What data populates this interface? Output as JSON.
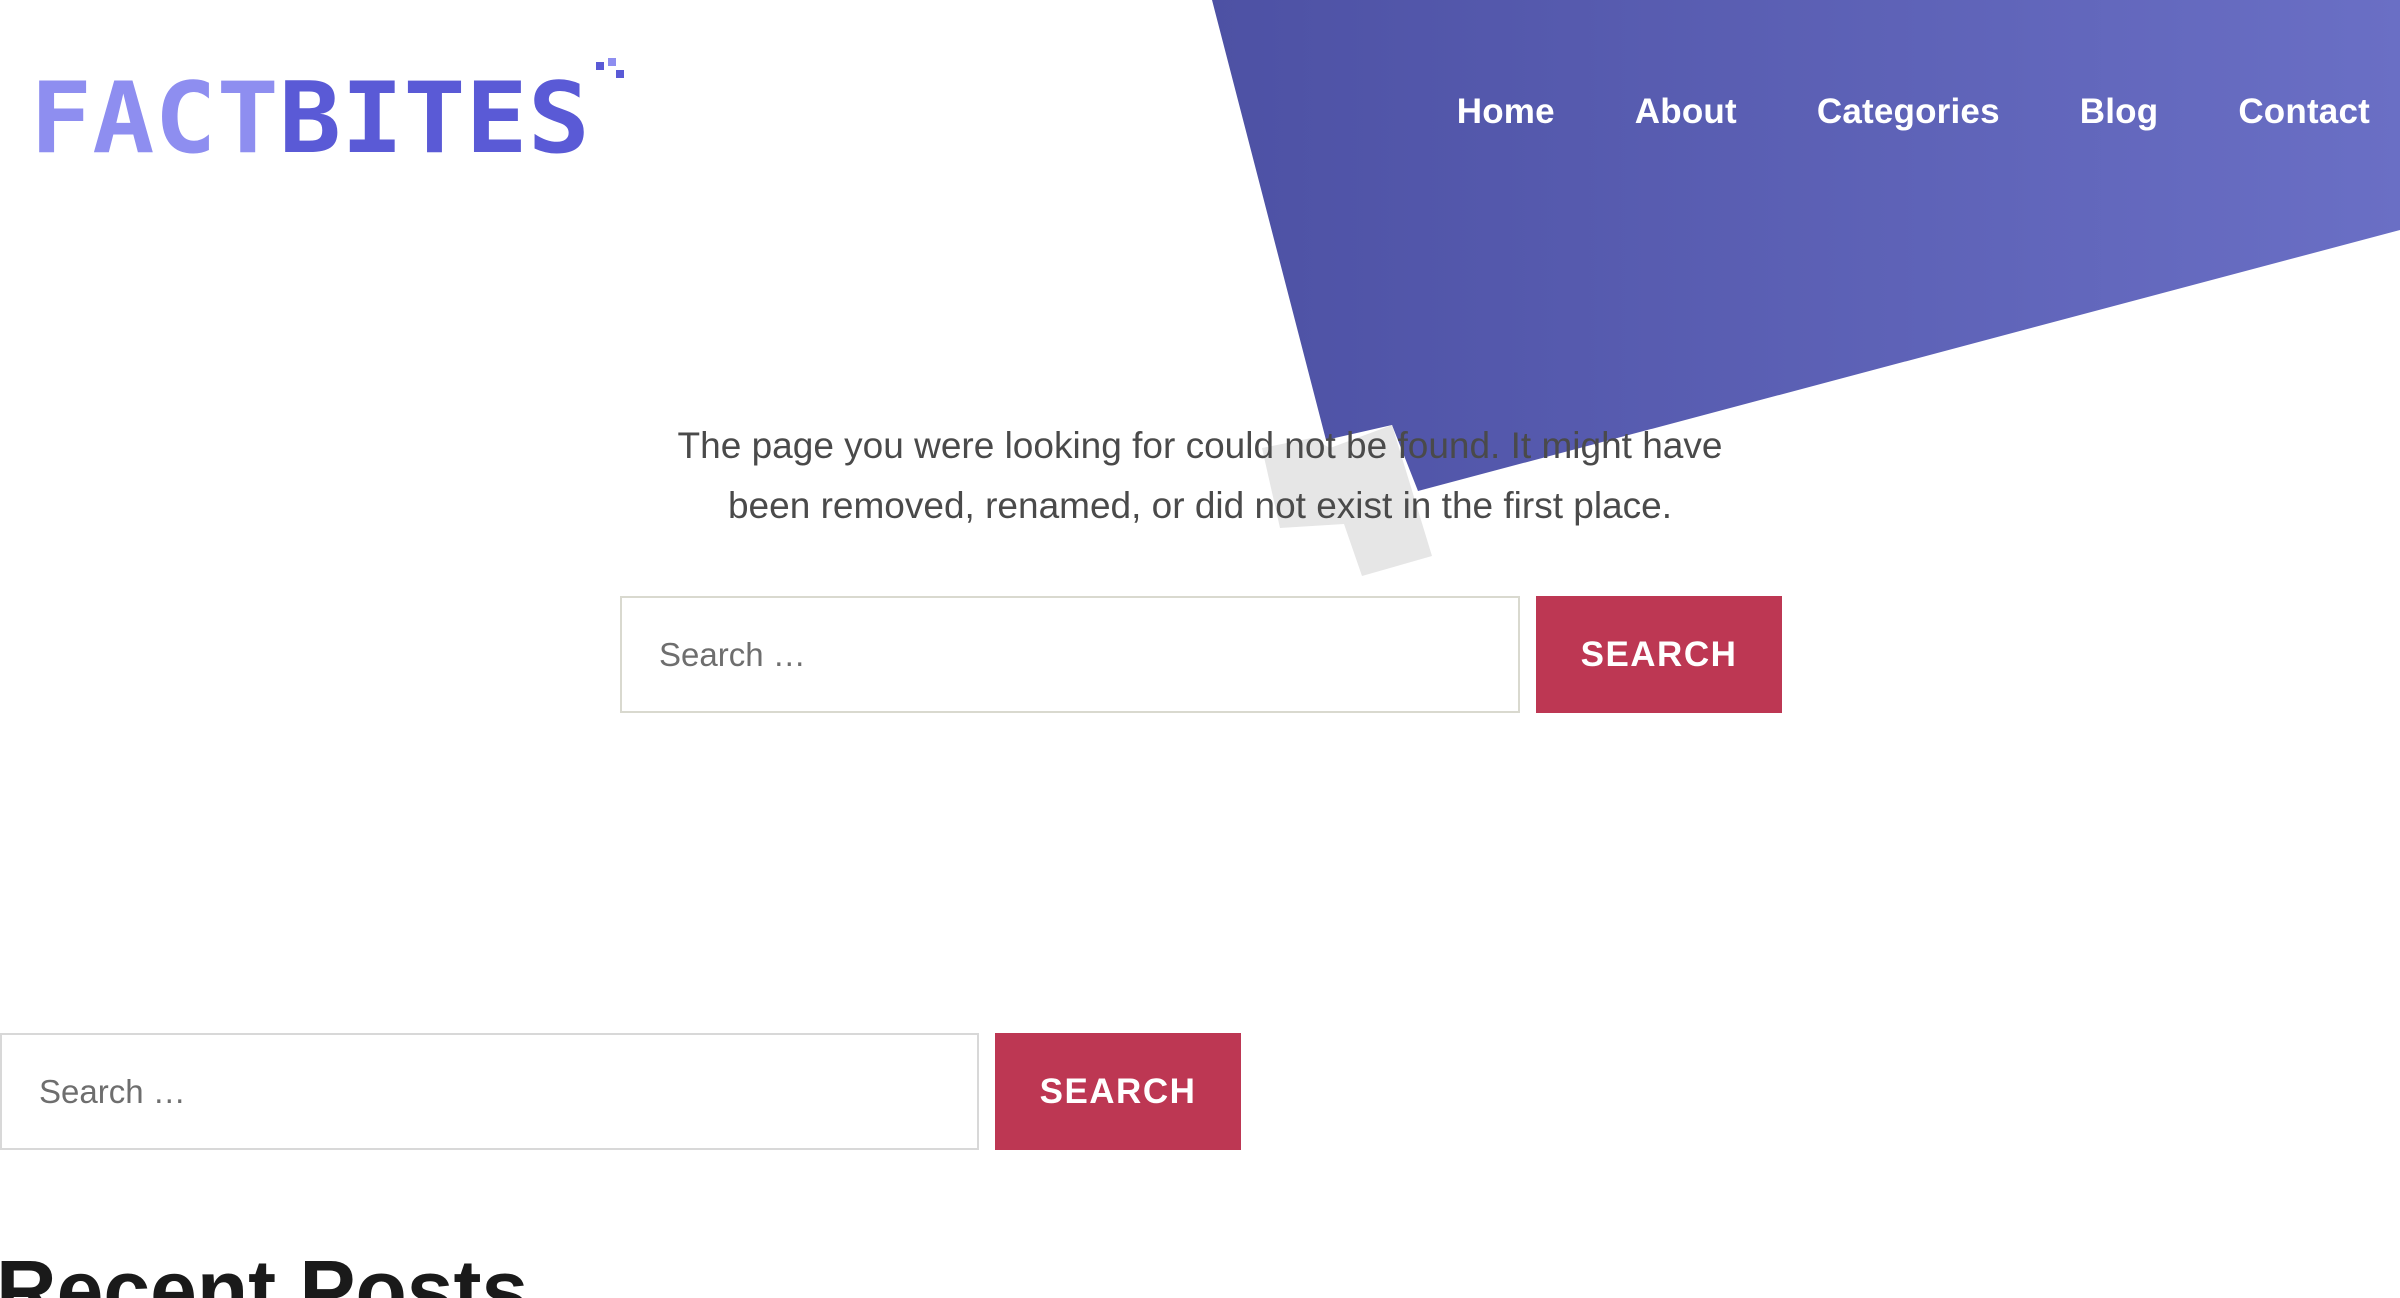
{
  "site": {
    "logo_text": "FACTBITES",
    "colors": {
      "logo_light": "#8e8ef0",
      "logo_dark": "#5a5ad6",
      "banner": "#5658b0",
      "accent": "#bd3753"
    }
  },
  "nav": {
    "items": [
      {
        "label": "Home"
      },
      {
        "label": "About"
      },
      {
        "label": "Categories"
      },
      {
        "label": "Blog"
      },
      {
        "label": "Contact"
      }
    ]
  },
  "error": {
    "line1": "The page you were looking for could not be found. It might have",
    "line2": "been removed, renamed, or did not exist in the first place."
  },
  "main_search": {
    "placeholder": "Search …",
    "button_label": "SEARCH"
  },
  "sidebar_search": {
    "placeholder": "Search …",
    "button_label": "SEARCH"
  },
  "recent_posts": {
    "title": "Recent Posts"
  }
}
